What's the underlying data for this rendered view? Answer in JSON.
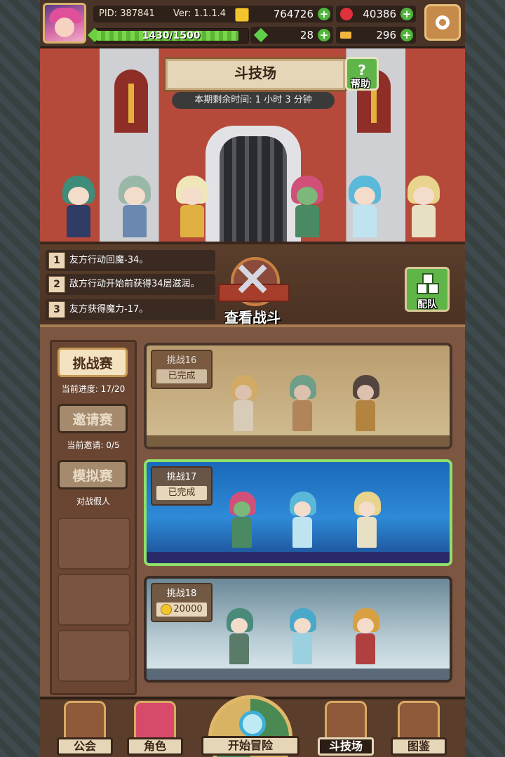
{
  "player": {
    "pid": "PID: 387841",
    "version": "Ver: 1.1.1.4",
    "xp_text": "1430/1500",
    "xp_fraction": 0.953
  },
  "currencies": {
    "gold": "764726",
    "gems": "40386",
    "clover": "28",
    "keys": "296"
  },
  "colors": {
    "gold": "#f2c52e",
    "gem": "#e0303a",
    "clover": "#5fd04a",
    "key": "#f2b640",
    "active_card_border": "#8fe06a"
  },
  "arena": {
    "title": "斗技场",
    "help_label": "帮助",
    "timer": "本期剩余时间: 1 小时 3 分钟",
    "view_battle": "查看战斗",
    "team_label": "配队",
    "buffs": [
      {
        "num": "1",
        "text": "友方行动回魔-34。"
      },
      {
        "num": "2",
        "text": "敌方行动开始前获得34层滋润。"
      },
      {
        "num": "3",
        "text": "友方获得魔力-17。"
      }
    ]
  },
  "tabs": [
    {
      "label": "挑战赛",
      "sub": "当前进度: 17/20"
    },
    {
      "label": "邀请赛",
      "sub": "当前邀请: 0/5"
    },
    {
      "label": "模拟赛",
      "sub": "对战假人"
    }
  ],
  "challenges": [
    {
      "title": "挑战16",
      "status": "已完成"
    },
    {
      "title": "挑战17",
      "status": "已完成"
    },
    {
      "title": "挑战18",
      "reward": "20000"
    }
  ],
  "nav": {
    "guild": "公会",
    "character": "角色",
    "adventure": "开始冒险",
    "arena": "斗技场",
    "codex": "图鉴"
  },
  "icons": [
    "gear-icon",
    "gold-coin-icon",
    "gem-icon",
    "clover-icon",
    "key-icon",
    "plus-icon",
    "question-icon",
    "crossed-swords-icon",
    "team-icon",
    "magnifier-icon",
    "book-icon",
    "shop-icon"
  ]
}
